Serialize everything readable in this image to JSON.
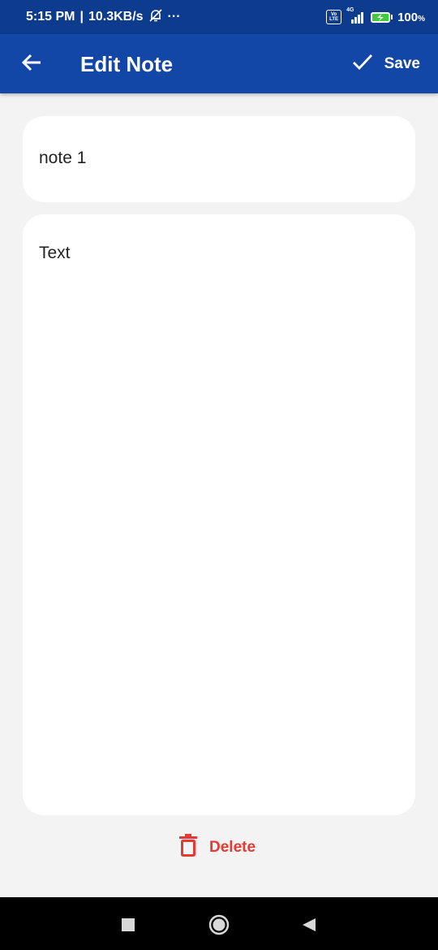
{
  "status_bar": {
    "time": "5:15 PM",
    "separator": "|",
    "speed": "10.3KB/s",
    "more": "···",
    "volte_top": "Vo",
    "volte_bottom": "LTE",
    "network": "4G",
    "battery_percent": "100",
    "battery_unit": "%"
  },
  "app_bar": {
    "title": "Edit Note",
    "save_label": "Save",
    "colors": {
      "background": "#1247a8",
      "status_background": "#0d3b8e"
    }
  },
  "note": {
    "title_value": "note 1",
    "body_value": "Text"
  },
  "actions": {
    "delete_label": "Delete",
    "delete_color": "#e53935"
  }
}
